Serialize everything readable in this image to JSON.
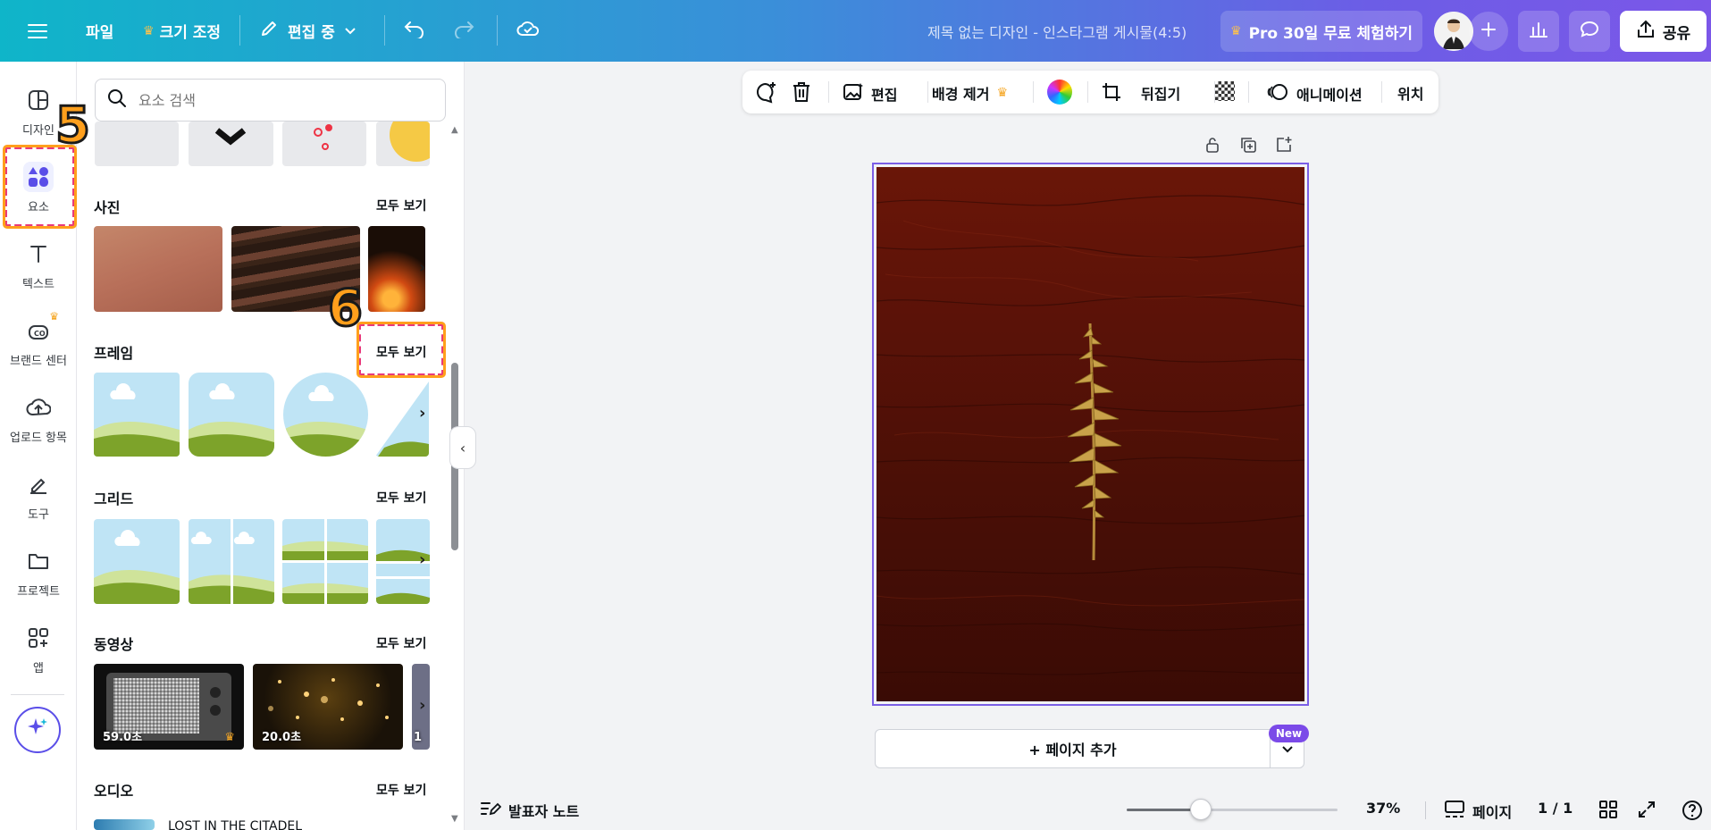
{
  "topbar": {
    "file_label": "파일",
    "resize_label": "크기 조정",
    "edit_mode_label": "편집 중",
    "doc_title": "제목 없는 디자인 - 인스타그램 게시물(4:5)",
    "pro_trial_label": "Pro 30일 무료 체험하기",
    "share_label": "공유"
  },
  "rail": {
    "items": [
      {
        "label": "디자인",
        "icon": "design-icon"
      },
      {
        "label": "요소",
        "icon": "elements-icon"
      },
      {
        "label": "텍스트",
        "icon": "text-icon"
      },
      {
        "label": "브랜드 센터",
        "icon": "brand-icon"
      },
      {
        "label": "업로드 항목",
        "icon": "upload-icon"
      },
      {
        "label": "도구",
        "icon": "tools-icon"
      },
      {
        "label": "프로젝트",
        "icon": "folder-icon"
      },
      {
        "label": "앱",
        "icon": "apps-icon"
      }
    ]
  },
  "panel": {
    "search_placeholder": "요소 검색",
    "see_all": "모두 보기",
    "sections": {
      "photos": "사진",
      "frames": "프레임",
      "grids": "그리드",
      "videos": "동영상",
      "audio": "오디오"
    },
    "video_durations": [
      "59.0초",
      "20.0초",
      "1"
    ],
    "audio_partial_title": "LOST IN THE CITADEL"
  },
  "annotations": {
    "n5": "5",
    "n6": "6"
  },
  "context_toolbar": {
    "edit_label": "편집",
    "bg_remove_label": "배경 제거",
    "flip_label": "뒤집기",
    "animate_label": "애니메이션",
    "position_label": "위치"
  },
  "canvas": {
    "add_page_label": "+ 페이지 추가",
    "new_badge": "New"
  },
  "bottombar": {
    "notes_label": "발표자 노트",
    "zoom": "37%",
    "zoom_fraction": 0.37,
    "pages_label": "페이지",
    "page_count": "1 / 1"
  },
  "colors": {
    "accent": "#7b5fe6",
    "annotation_dash": "#e83a7a",
    "annotation_number": "#ff9f1c",
    "wood": "#5a1208"
  }
}
